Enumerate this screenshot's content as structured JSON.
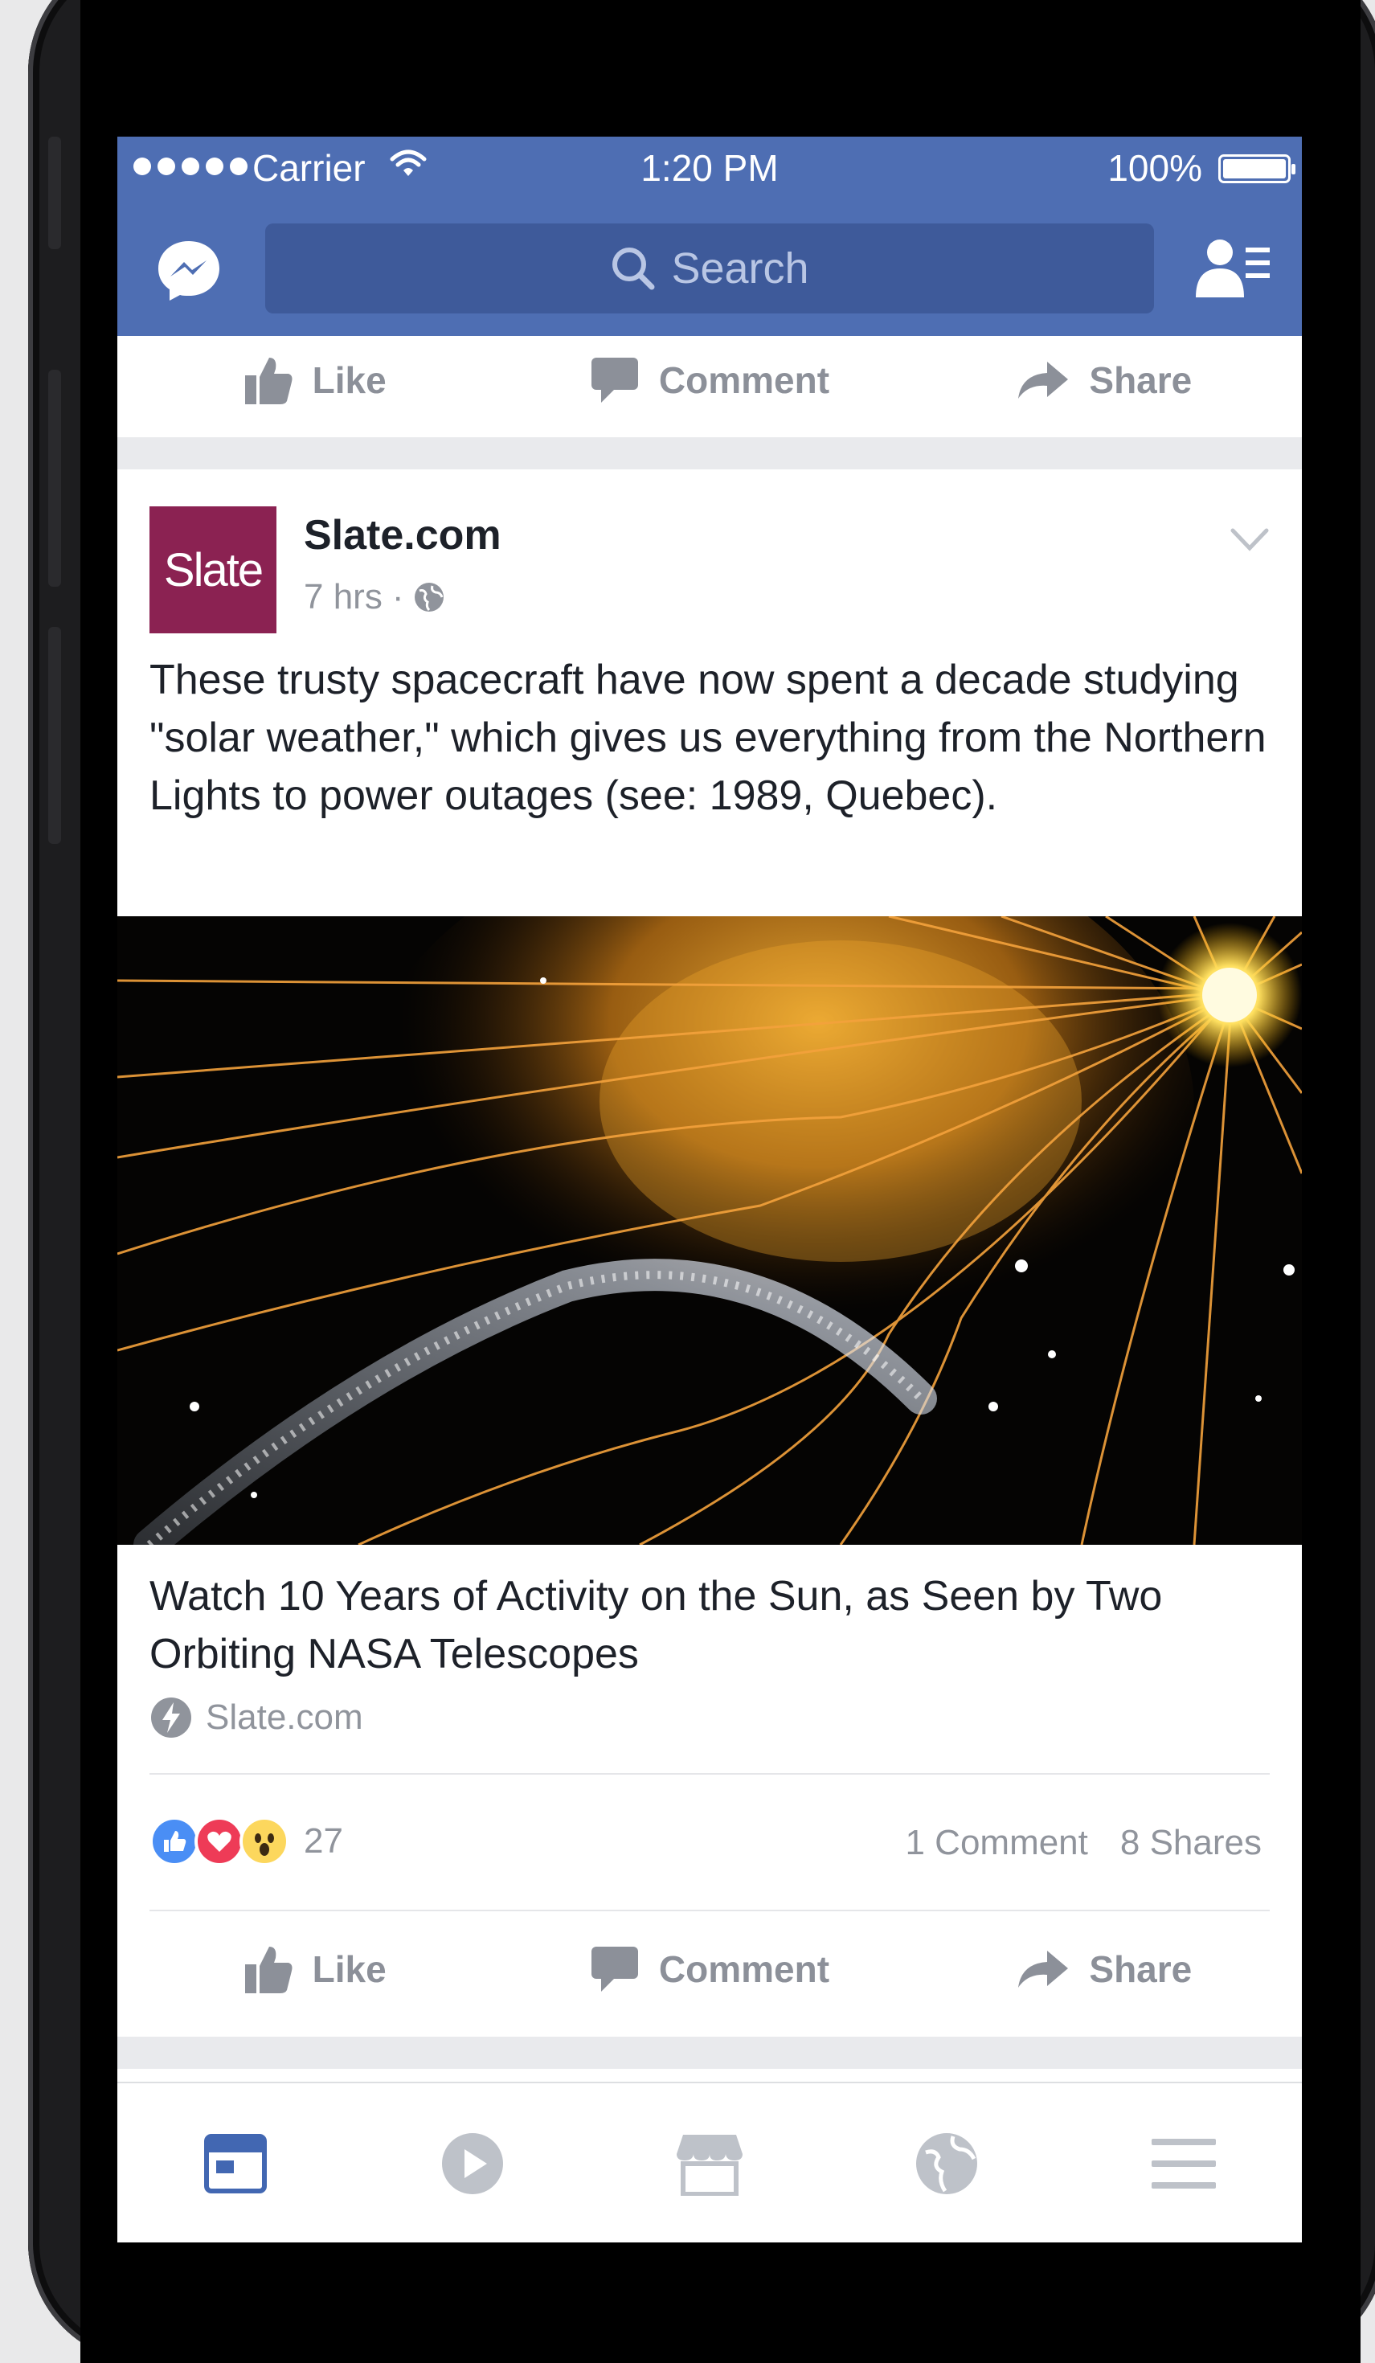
{
  "status_bar": {
    "carrier": "Carrier",
    "time": "1:20 PM",
    "battery": "100%"
  },
  "nav": {
    "search_placeholder": "Search"
  },
  "prev_post_actions": {
    "like": "Like",
    "comment": "Comment",
    "share": "Share"
  },
  "post": {
    "logo_text": "Slate",
    "page_name": "Slate.com",
    "time": "7 hrs",
    "separator": "·",
    "text": "These trusty spacecraft have now spent a decade studying \"solar weather,\" which gives us everything from the Northern Lights to power outages (see: 1989, Quebec).",
    "link": {
      "title": "Watch 10 Years of Activity on the Sun, as Seen by Two Orbiting NASA Telescopes",
      "source": "Slate.com"
    },
    "reactions": {
      "count": "27",
      "comments": "1 Comment",
      "shares": "8 Shares"
    },
    "actions": {
      "like": "Like",
      "comment": "Comment",
      "share": "Share"
    }
  },
  "colors": {
    "nav_blue": "#4e6eb3",
    "search_bg": "#3e5a9a",
    "slate_logo": "#8b2252",
    "tab_active": "#4267b2",
    "tab_inactive": "#bec2c9"
  },
  "tabs": [
    "news-feed-icon",
    "video-icon",
    "marketplace-icon",
    "notifications-globe-icon",
    "menu-icon"
  ]
}
